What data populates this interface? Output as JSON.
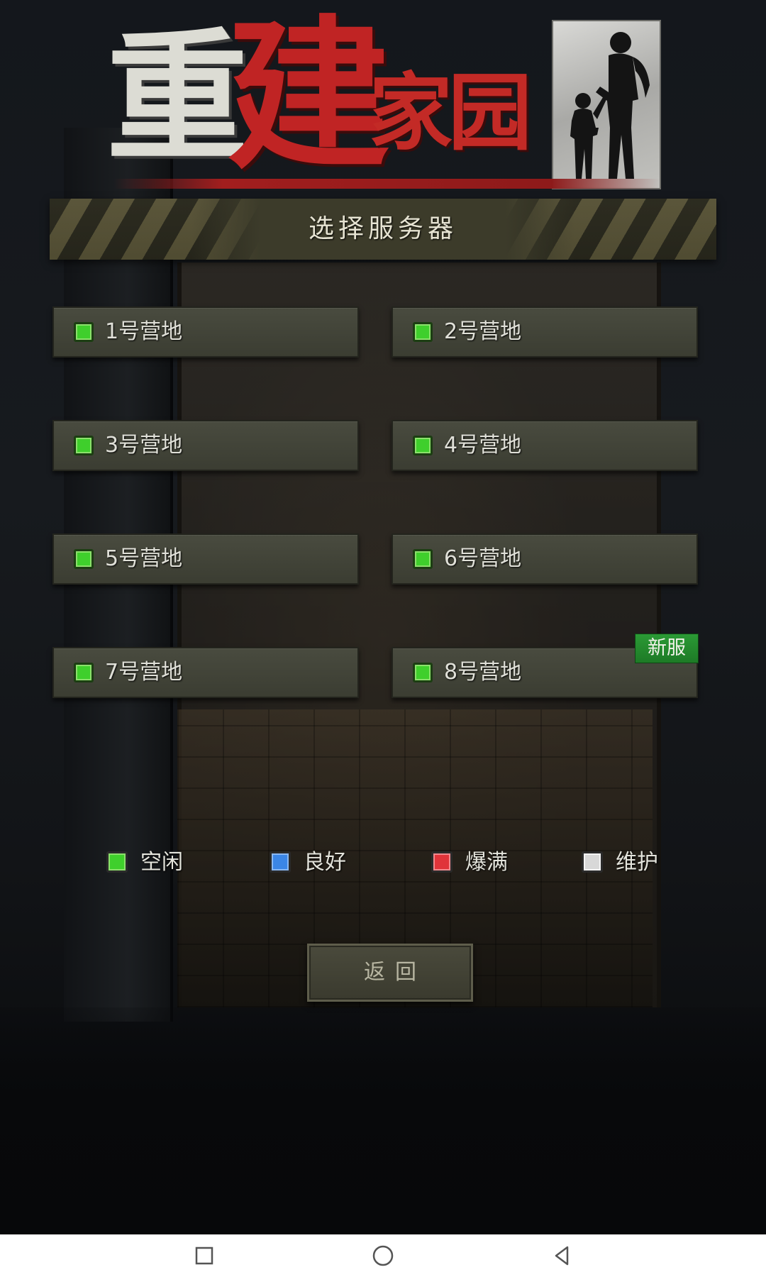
{
  "logo": {
    "char1": "重",
    "char2": "建",
    "char3": "家园"
  },
  "header": {
    "title": "选择服务器"
  },
  "servers": [
    {
      "name": "1号营地",
      "status": "idle",
      "status_color": "#3fcf2c"
    },
    {
      "name": "2号营地",
      "status": "idle",
      "status_color": "#3fcf2c"
    },
    {
      "name": "3号营地",
      "status": "idle",
      "status_color": "#3fcf2c"
    },
    {
      "name": "4号营地",
      "status": "idle",
      "status_color": "#3fcf2c"
    },
    {
      "name": "5号营地",
      "status": "idle",
      "status_color": "#3fcf2c"
    },
    {
      "name": "6号营地",
      "status": "idle",
      "status_color": "#3fcf2c"
    },
    {
      "name": "7号营地",
      "status": "idle",
      "status_color": "#3fcf2c"
    },
    {
      "name": "8号营地",
      "status": "idle",
      "status_color": "#3fcf2c",
      "badge": "新服"
    }
  ],
  "legend": [
    {
      "label": "空闲",
      "color": "#3fcf2c"
    },
    {
      "label": "良好",
      "color": "#3b86e6"
    },
    {
      "label": "爆满",
      "color": "#e0343a"
    },
    {
      "label": "维护",
      "color": "#d8d8d8"
    }
  ],
  "footer": {
    "back_label": "返回"
  },
  "navbar": {
    "icons": [
      "square-recents-icon",
      "circle-home-icon",
      "triangle-back-icon"
    ]
  }
}
